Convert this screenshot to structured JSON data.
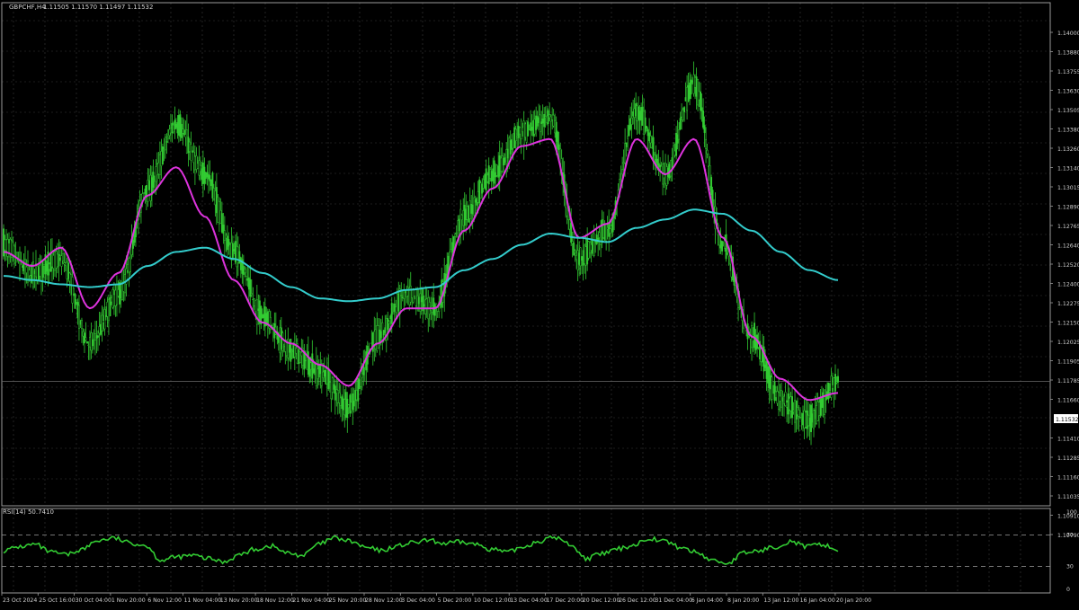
{
  "header": {
    "symbol_info": "GBPCHF,H4",
    "ohlc": "1.11505 1.11570 1.11497 1.11532"
  },
  "price_panel": {
    "price_labels": [
      "1.14000",
      "1.13880",
      "1.13755",
      "1.13630",
      "1.13505",
      "1.13380",
      "1.13260",
      "1.13140",
      "1.13015",
      "1.12890",
      "1.12765",
      "1.12640",
      "1.12520",
      "1.12400",
      "1.12275",
      "1.12150",
      "1.12025",
      "1.11905",
      "1.11785",
      "1.11660",
      "1.11532",
      "1.11410",
      "1.11285",
      "1.11160",
      "1.11035",
      "1.10910",
      "1.10790"
    ],
    "current_price": "1.11532"
  },
  "rsi_panel": {
    "label": "RSI(14) 50.7410",
    "levels": [
      "100",
      "70",
      "30",
      "0"
    ]
  },
  "time_axis": {
    "labels": [
      "23 Oct 2024",
      "25 Oct 16:00",
      "30 Oct 04:00",
      "1 Nov 20:00",
      "6 Nov 12:00",
      "11 Nov 04:00",
      "13 Nov 20:00",
      "18 Nov 12:00",
      "21 Nov 04:00",
      "25 Nov 20:00",
      "28 Nov 12:00",
      "3 Dec 04:00",
      "5 Dec 20:00",
      "10 Dec 12:00",
      "13 Dec 04:00",
      "17 Dec 20:00",
      "20 Dec 12:00",
      "26 Dec 12:00",
      "31 Dec 04:00",
      "6 Jan 04:00",
      "8 Jan 20:00",
      "13 Jan 12:00",
      "16 Jan 04:00",
      "20 Jan 20:00"
    ]
  },
  "colors": {
    "background": "#000000",
    "candles": "#33cc33",
    "ma_fast": "#dd33dd",
    "ma_slow": "#33cccc",
    "rsi": "#33cc33",
    "grid": "#3a3a3a",
    "text": "#cfcfcf"
  },
  "chart_data": [
    {
      "type": "candlestick",
      "title": "GBPCHF,H4",
      "y_range": [
        1.1079,
        1.14
      ],
      "x_range": [
        "23 Oct 2024",
        "20 Jan 20:00"
      ],
      "grid": true,
      "close_path": [
        {
          "x": "23 Oct 2024",
          "y": 1.125
        },
        {
          "x": "25 Oct 16:00",
          "y": 1.123
        },
        {
          "x": "30 Oct 04:00",
          "y": 1.124
        },
        {
          "x": "31 Oct",
          "y": 1.118
        },
        {
          "x": "1 Nov 20:00",
          "y": 1.1215
        },
        {
          "x": "6 Nov 12:00",
          "y": 1.129
        },
        {
          "x": "8 Nov",
          "y": 1.1335
        },
        {
          "x": "11 Nov 04:00",
          "y": 1.13
        },
        {
          "x": "13 Nov 20:00",
          "y": 1.1245
        },
        {
          "x": "15 Nov",
          "y": 1.12
        },
        {
          "x": "18 Nov 12:00",
          "y": 1.1175
        },
        {
          "x": "21 Nov 04:00",
          "y": 1.116
        },
        {
          "x": "25 Nov 20:00",
          "y": 1.1135
        },
        {
          "x": "28 Nov 12:00",
          "y": 1.1185
        },
        {
          "x": "3 Dec 04:00",
          "y": 1.1215
        },
        {
          "x": "5 Dec 20:00",
          "y": 1.1205
        },
        {
          "x": "10 Dec 12:00",
          "y": 1.127
        },
        {
          "x": "12 Dec",
          "y": 1.13
        },
        {
          "x": "13 Dec 04:00",
          "y": 1.133
        },
        {
          "x": "17 Dec 20:00",
          "y": 1.134
        },
        {
          "x": "18 Dec",
          "y": 1.124
        },
        {
          "x": "20 Dec 12:00",
          "y": 1.126
        },
        {
          "x": "26 Dec 12:00",
          "y": 1.1345
        },
        {
          "x": "31 Dec 04:00",
          "y": 1.13
        },
        {
          "x": "6 Jan 04:00",
          "y": 1.1365
        },
        {
          "x": "7 Jan",
          "y": 1.125
        },
        {
          "x": "8 Jan 20:00",
          "y": 1.1185
        },
        {
          "x": "13 Jan 12:00",
          "y": 1.114
        },
        {
          "x": "16 Jan 04:00",
          "y": 1.1125
        },
        {
          "x": "20 Jan 20:00",
          "y": 1.1153
        }
      ],
      "series": [
        {
          "name": "MA fast",
          "values": [
            1.1245,
            1.1235,
            1.1248,
            1.1205,
            1.123,
            1.1285,
            1.1305,
            1.127,
            1.1225,
            1.1195,
            1.118,
            1.1165,
            1.115,
            1.118,
            1.1205,
            1.1205,
            1.126,
            1.129,
            1.132,
            1.1325,
            1.1255,
            1.1265,
            1.1325,
            1.13,
            1.1325,
            1.1255,
            1.1185,
            1.1155,
            1.114,
            1.1145
          ]
        },
        {
          "name": "MA slow",
          "values": [
            1.1228,
            1.1225,
            1.1222,
            1.122,
            1.1222,
            1.1235,
            1.1245,
            1.1248,
            1.124,
            1.123,
            1.122,
            1.1212,
            1.121,
            1.1212,
            1.1218,
            1.122,
            1.1232,
            1.124,
            1.125,
            1.1258,
            1.1255,
            1.1252,
            1.1262,
            1.1268,
            1.1275,
            1.1272,
            1.126,
            1.1245,
            1.1232,
            1.1225
          ]
        }
      ]
    },
    {
      "type": "line",
      "title": "RSI(14) 50.7410",
      "y_range": [
        0,
        100
      ],
      "levels": [
        30,
        70
      ],
      "series": [
        {
          "name": "RSI(14)",
          "values": [
            50,
            55,
            58,
            48,
            45,
            52,
            63,
            66,
            60,
            57,
            38,
            42,
            44,
            40,
            36,
            45,
            52,
            56,
            47,
            44,
            58,
            66,
            62,
            54,
            50,
            56,
            60,
            63,
            59,
            61,
            58,
            52,
            48,
            55,
            62,
            67,
            58,
            40,
            46,
            52,
            57,
            66,
            62,
            54,
            48,
            38,
            34,
            47,
            50,
            55,
            62,
            55,
            58,
            50.7
          ]
        }
      ]
    }
  ]
}
